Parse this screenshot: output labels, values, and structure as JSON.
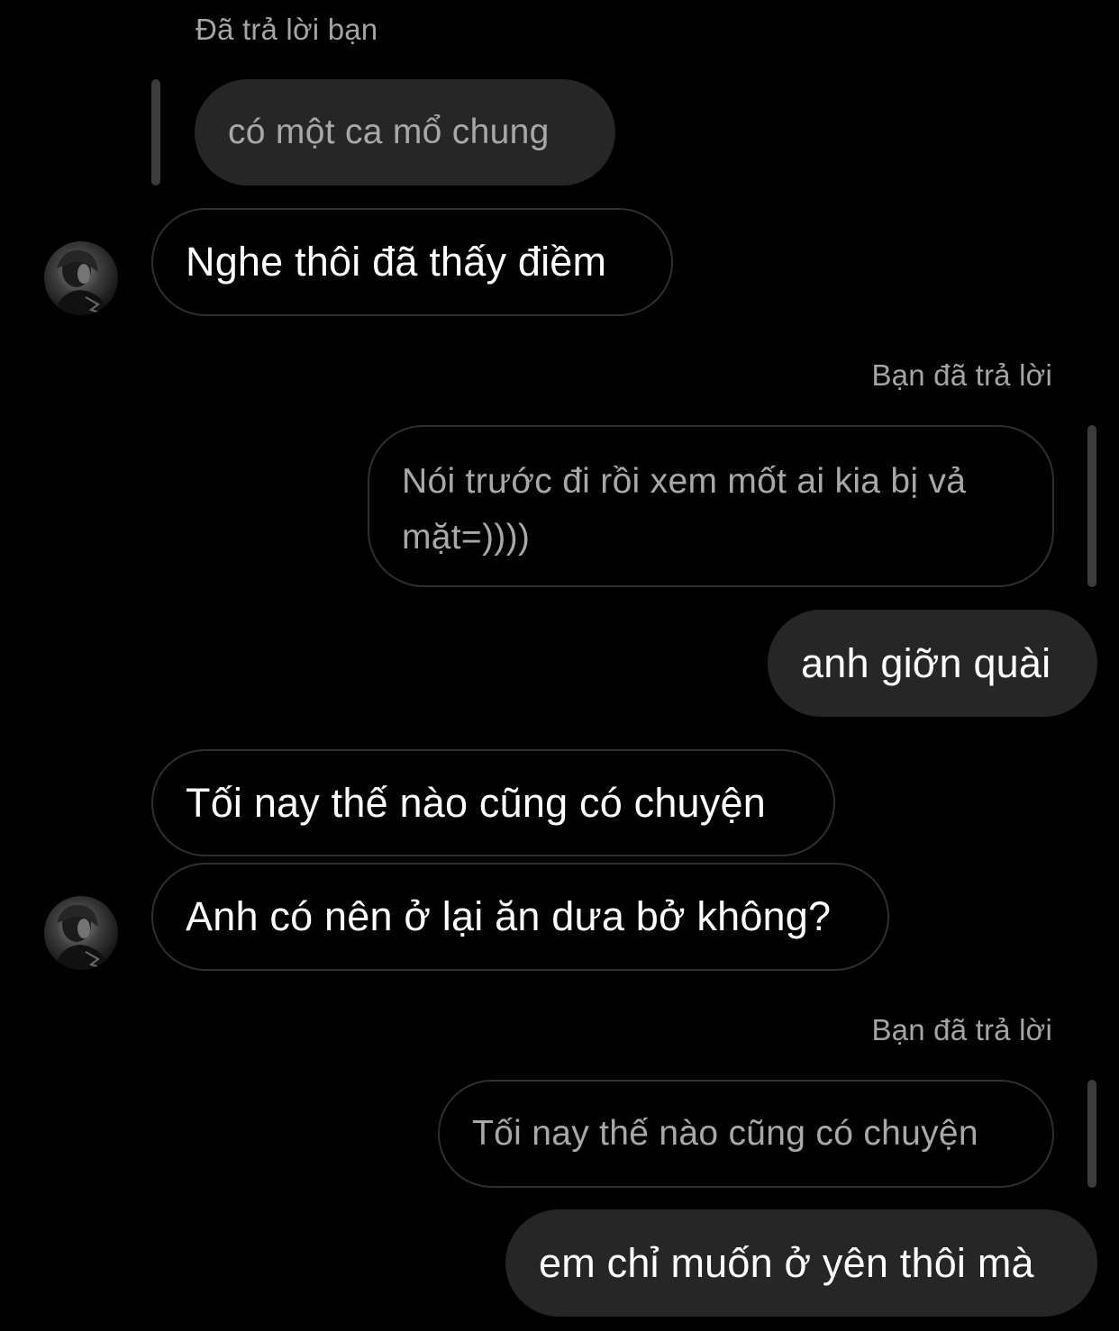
{
  "chat": {
    "reply_1": {
      "label": "Đã trả lời bạn",
      "quoted": "có một ca mổ chung"
    },
    "msg_1": "Nghe thôi đã thấy điềm",
    "reply_2": {
      "label": "Bạn đã trả lời",
      "quoted_line1": "Nói trước đi rồi xem mốt ai kia bị vả",
      "quoted_line2": "mặt=))))"
    },
    "msg_2": "anh giỡn quài",
    "msg_3": "Tối nay thế nào cũng có chuyện",
    "msg_4": "Anh có nên ở lại ăn dưa bở không?",
    "reply_3": {
      "label": "Bạn đã trả lời",
      "quoted": "Tối nay thế nào cũng có chuyện"
    },
    "msg_5": "em chỉ muốn ở yên thôi mà"
  },
  "colors": {
    "background": "#000000",
    "bubble_filled": "#262626",
    "bubble_outline": "#2f2f2f",
    "reply_label": "#a4a4a4",
    "quoted_text": "#a8a8a8",
    "reply_bar": "#3c3c3c"
  },
  "icons": {
    "avatar": "contact-avatar-photo"
  }
}
